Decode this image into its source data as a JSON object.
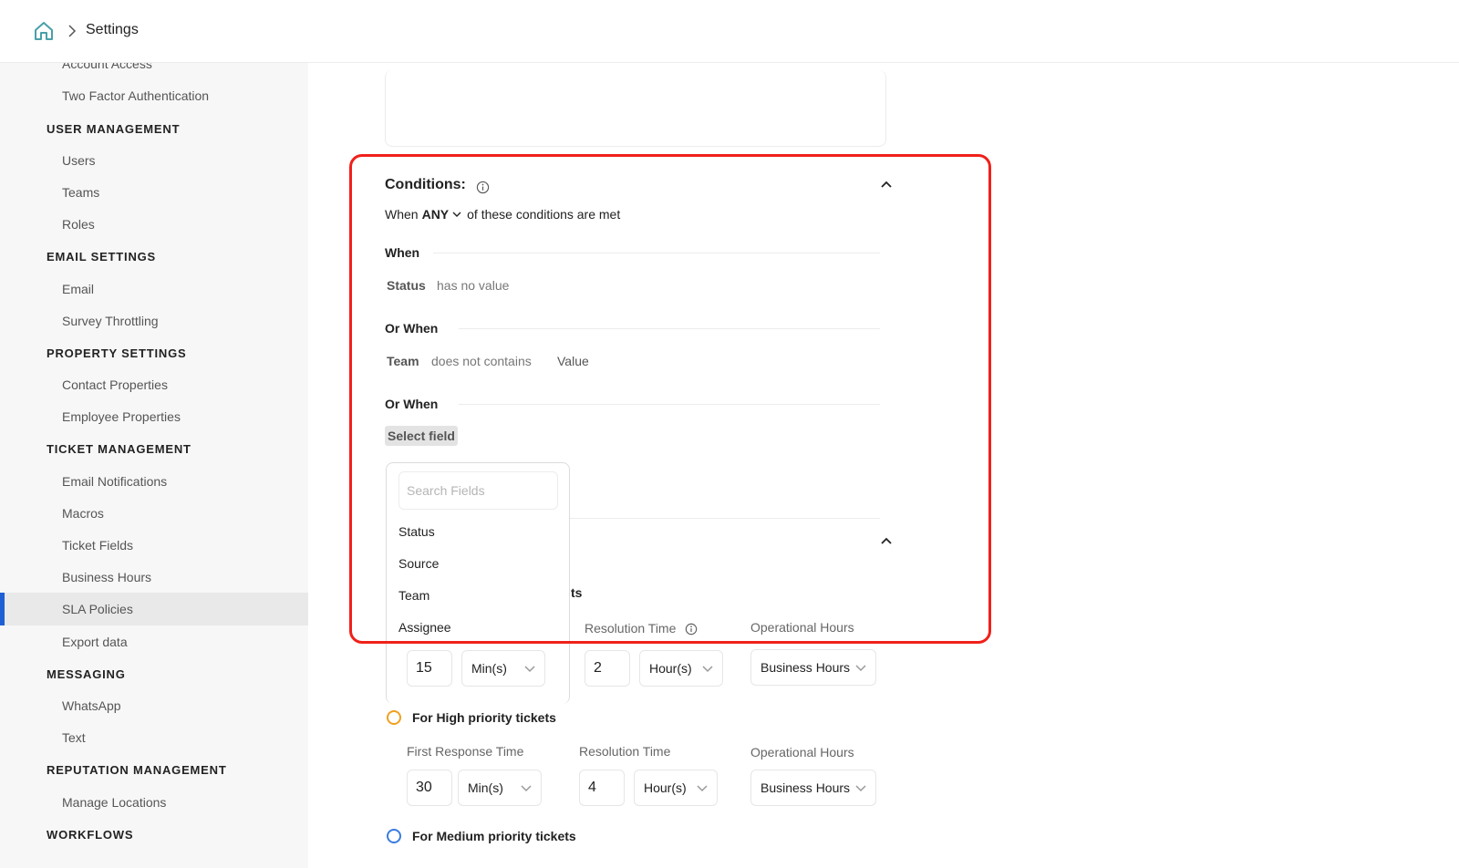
{
  "breadcrumb": {
    "current": "Settings"
  },
  "sidebar": {
    "items": [
      {
        "label": "Account Access",
        "top": 0
      },
      {
        "label": "Two Factor Authentication"
      }
    ],
    "sections": [
      {
        "title": "USER MANAGEMENT",
        "items": [
          "Users",
          "Teams",
          "Roles"
        ]
      },
      {
        "title": "EMAIL SETTINGS",
        "items": [
          "Email",
          "Survey Throttling"
        ]
      },
      {
        "title": "PROPERTY SETTINGS",
        "items": [
          "Contact Properties",
          "Employee Properties"
        ]
      },
      {
        "title": "TICKET MANAGEMENT",
        "items": [
          "Email Notifications",
          "Macros",
          "Ticket Fields",
          "Business Hours",
          "SLA Policies",
          "Export data"
        ]
      },
      {
        "title": "MESSAGING",
        "items": [
          "WhatsApp",
          "Text"
        ]
      },
      {
        "title": "REPUTATION MANAGEMENT",
        "items": [
          "Manage Locations"
        ]
      },
      {
        "title": "WORKFLOWS",
        "items": []
      }
    ],
    "active_item": "SLA Policies"
  },
  "conditions": {
    "title": "Conditions:",
    "match_prefix": "When",
    "match_mode": "ANY",
    "match_suffix": "of these conditions are met",
    "groups": [
      {
        "label": "When",
        "field": "Status",
        "operator": "has no value",
        "value": ""
      },
      {
        "label": "Or When",
        "field": "Team",
        "operator": "does not contains",
        "value": "Value"
      },
      {
        "label": "Or When",
        "field": "",
        "operator": "",
        "value": ""
      }
    ],
    "select_field_label": "Select field",
    "dropdown": {
      "search_placeholder": "Search Fields",
      "options": [
        "Status",
        "Source",
        "Team",
        "Assignee"
      ]
    }
  },
  "sla": {
    "partial_heading_tail": "ts",
    "partial_labels": {
      "resolution": "Resolution Time",
      "operational": "Operational Hours"
    },
    "urgent_row": {
      "first_response": "15",
      "first_unit": "Min(s)",
      "resolution": "2",
      "resolution_unit": "Hour(s)",
      "operational": "Business Hours"
    },
    "high": {
      "title": "For High priority tickets",
      "first_response_label": "First Response Time",
      "resolution_label": "Resolution Time",
      "operational_label": "Operational Hours",
      "first_response": "30",
      "first_unit": "Min(s)",
      "resolution": "4",
      "resolution_unit": "Hour(s)",
      "operational": "Business Hours"
    },
    "medium": {
      "title": "For Medium priority tickets"
    }
  },
  "colors": {
    "highlight": "#f0201a",
    "active_indicator": "#1f5fd6",
    "high_priority": "#f0a020",
    "medium_priority": "#3a7be0",
    "home_icon": "#4aa0a8"
  }
}
